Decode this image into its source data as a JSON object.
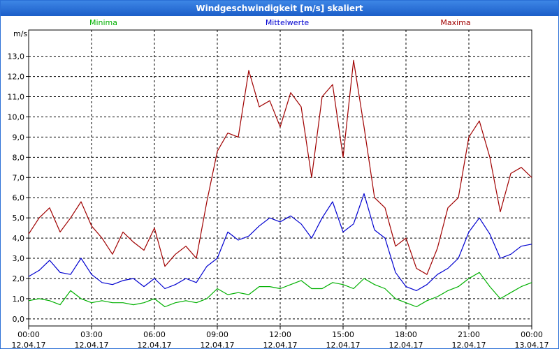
{
  "window": {
    "title": "Windgeschwindigkeit [m/s] skaliert"
  },
  "chart_data": {
    "type": "line",
    "title": "Windgeschwindigkeit [m/s] skaliert",
    "ylabel": "m/s",
    "ylim": [
      -0.35,
      14.3
    ],
    "xlim_hours": [
      0,
      24
    ],
    "y_ticks": [
      "0,0",
      "1,0",
      "2,0",
      "3,0",
      "4,0",
      "5,0",
      "6,0",
      "7,0",
      "8,0",
      "9,0",
      "10,0",
      "11,0",
      "12,0",
      "13,0"
    ],
    "x_ticks": [
      {
        "time": "00:00",
        "date": "12.04.17"
      },
      {
        "time": "03:00",
        "date": "12.04.17"
      },
      {
        "time": "06:00",
        "date": "12.04.17"
      },
      {
        "time": "09:00",
        "date": "12.04.17"
      },
      {
        "time": "12:00",
        "date": "12.04.17"
      },
      {
        "time": "15:00",
        "date": "12.04.17"
      },
      {
        "time": "18:00",
        "date": "12.04.17"
      },
      {
        "time": "21:00",
        "date": "12.04.17"
      },
      {
        "time": "00:00",
        "date": "13.04.17"
      }
    ],
    "grid": true,
    "colors": {
      "minima": "#00b000",
      "mittelwerte": "#0000d0",
      "maxima": "#a00000"
    },
    "legend_labels": [
      "Minima",
      "Mittelwerte",
      "Maxima"
    ],
    "series": [
      {
        "name": "Minima",
        "color": "#00b000",
        "points": [
          [
            0.0,
            0.9
          ],
          [
            0.5,
            1.0
          ],
          [
            1.0,
            0.9
          ],
          [
            1.5,
            0.7
          ],
          [
            2.0,
            1.4
          ],
          [
            2.5,
            1.0
          ],
          [
            3.0,
            0.8
          ],
          [
            3.5,
            0.9
          ],
          [
            4.0,
            0.8
          ],
          [
            4.5,
            0.8
          ],
          [
            5.0,
            0.7
          ],
          [
            5.5,
            0.8
          ],
          [
            6.0,
            1.0
          ],
          [
            6.5,
            0.6
          ],
          [
            7.0,
            0.8
          ],
          [
            7.5,
            0.9
          ],
          [
            8.0,
            0.8
          ],
          [
            8.5,
            1.0
          ],
          [
            9.0,
            1.5
          ],
          [
            9.5,
            1.2
          ],
          [
            10.0,
            1.3
          ],
          [
            10.5,
            1.2
          ],
          [
            11.0,
            1.6
          ],
          [
            11.5,
            1.6
          ],
          [
            12.0,
            1.5
          ],
          [
            12.5,
            1.7
          ],
          [
            13.0,
            1.9
          ],
          [
            13.5,
            1.5
          ],
          [
            14.0,
            1.5
          ],
          [
            14.5,
            1.8
          ],
          [
            15.0,
            1.7
          ],
          [
            15.5,
            1.5
          ],
          [
            16.0,
            2.0
          ],
          [
            16.5,
            1.7
          ],
          [
            17.0,
            1.5
          ],
          [
            17.5,
            1.0
          ],
          [
            18.0,
            0.8
          ],
          [
            18.5,
            0.6
          ],
          [
            19.0,
            0.9
          ],
          [
            19.5,
            1.1
          ],
          [
            20.0,
            1.4
          ],
          [
            20.5,
            1.6
          ],
          [
            21.0,
            2.0
          ],
          [
            21.5,
            2.3
          ],
          [
            22.0,
            1.6
          ],
          [
            22.5,
            1.0
          ],
          [
            23.0,
            1.3
          ],
          [
            23.5,
            1.6
          ],
          [
            24.0,
            1.8
          ]
        ]
      },
      {
        "name": "Mittelwerte",
        "color": "#0000d0",
        "points": [
          [
            0.0,
            2.1
          ],
          [
            0.5,
            2.4
          ],
          [
            1.0,
            2.9
          ],
          [
            1.5,
            2.3
          ],
          [
            2.0,
            2.2
          ],
          [
            2.5,
            3.0
          ],
          [
            3.0,
            2.2
          ],
          [
            3.5,
            1.8
          ],
          [
            4.0,
            1.7
          ],
          [
            4.5,
            1.9
          ],
          [
            5.0,
            2.0
          ],
          [
            5.5,
            1.6
          ],
          [
            6.0,
            2.0
          ],
          [
            6.5,
            1.5
          ],
          [
            7.0,
            1.7
          ],
          [
            7.5,
            2.0
          ],
          [
            8.0,
            1.8
          ],
          [
            8.5,
            2.6
          ],
          [
            9.0,
            3.0
          ],
          [
            9.5,
            4.3
          ],
          [
            10.0,
            3.9
          ],
          [
            10.5,
            4.1
          ],
          [
            11.0,
            4.6
          ],
          [
            11.5,
            5.0
          ],
          [
            12.0,
            4.8
          ],
          [
            12.5,
            5.1
          ],
          [
            13.0,
            4.7
          ],
          [
            13.5,
            4.0
          ],
          [
            14.0,
            5.0
          ],
          [
            14.5,
            5.8
          ],
          [
            15.0,
            4.3
          ],
          [
            15.5,
            4.7
          ],
          [
            16.0,
            6.2
          ],
          [
            16.5,
            4.4
          ],
          [
            17.0,
            4.0
          ],
          [
            17.5,
            2.3
          ],
          [
            18.0,
            1.6
          ],
          [
            18.5,
            1.4
          ],
          [
            19.0,
            1.7
          ],
          [
            19.5,
            2.2
          ],
          [
            20.0,
            2.5
          ],
          [
            20.5,
            3.0
          ],
          [
            21.0,
            4.3
          ],
          [
            21.5,
            5.0
          ],
          [
            22.0,
            4.2
          ],
          [
            22.5,
            3.0
          ],
          [
            23.0,
            3.2
          ],
          [
            23.5,
            3.6
          ],
          [
            24.0,
            3.7
          ]
        ]
      },
      {
        "name": "Maxima",
        "color": "#a00000",
        "points": [
          [
            0.0,
            4.2
          ],
          [
            0.5,
            5.0
          ],
          [
            1.0,
            5.5
          ],
          [
            1.5,
            4.3
          ],
          [
            2.0,
            5.0
          ],
          [
            2.5,
            5.8
          ],
          [
            3.0,
            4.6
          ],
          [
            3.5,
            4.0
          ],
          [
            4.0,
            3.2
          ],
          [
            4.5,
            4.3
          ],
          [
            5.0,
            3.8
          ],
          [
            5.5,
            3.4
          ],
          [
            6.0,
            4.5
          ],
          [
            6.5,
            2.6
          ],
          [
            7.0,
            3.2
          ],
          [
            7.5,
            3.6
          ],
          [
            8.0,
            3.0
          ],
          [
            8.5,
            5.8
          ],
          [
            9.0,
            8.3
          ],
          [
            9.5,
            9.2
          ],
          [
            10.0,
            9.0
          ],
          [
            10.5,
            12.3
          ],
          [
            11.0,
            10.5
          ],
          [
            11.5,
            10.8
          ],
          [
            12.0,
            9.5
          ],
          [
            12.5,
            11.2
          ],
          [
            13.0,
            10.5
          ],
          [
            13.5,
            7.0
          ],
          [
            14.0,
            11.0
          ],
          [
            14.5,
            11.6
          ],
          [
            15.0,
            8.0
          ],
          [
            15.5,
            12.8
          ],
          [
            16.0,
            9.5
          ],
          [
            16.5,
            6.0
          ],
          [
            17.0,
            5.5
          ],
          [
            17.5,
            3.6
          ],
          [
            18.0,
            4.0
          ],
          [
            18.5,
            2.5
          ],
          [
            19.0,
            2.2
          ],
          [
            19.5,
            3.5
          ],
          [
            20.0,
            5.5
          ],
          [
            20.5,
            6.0
          ],
          [
            21.0,
            9.0
          ],
          [
            21.5,
            9.8
          ],
          [
            22.0,
            8.0
          ],
          [
            22.5,
            5.3
          ],
          [
            23.0,
            7.2
          ],
          [
            23.5,
            7.5
          ],
          [
            24.0,
            7.0
          ]
        ]
      }
    ]
  }
}
